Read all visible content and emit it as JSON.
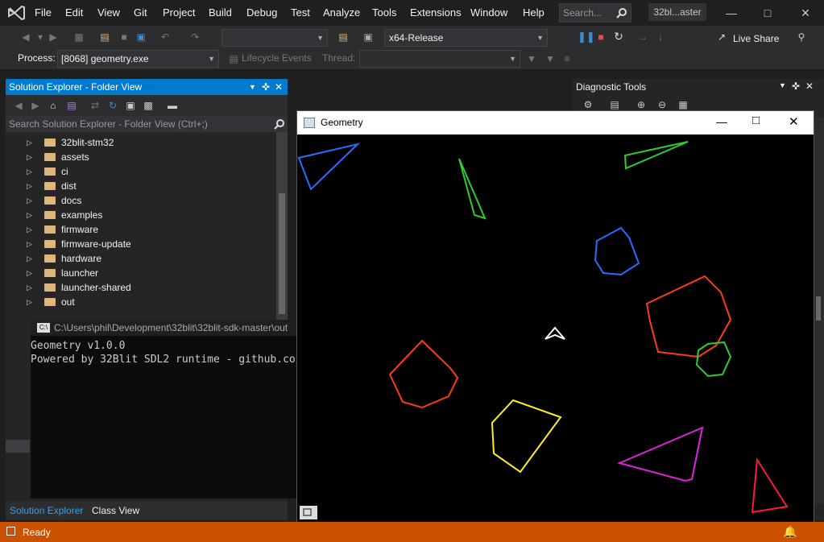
{
  "menu": [
    "File",
    "Edit",
    "View",
    "Git",
    "Project",
    "Build",
    "Debug",
    "Test",
    "Analyze",
    "Tools",
    "Extensions",
    "Window",
    "Help"
  ],
  "search": {
    "placeholder": "Search..."
  },
  "window_title": "32bl...aster",
  "toolbar": {
    "config_value": "",
    "platform_value": "x64-Release",
    "live_share_label": "Live Share"
  },
  "debug_bar": {
    "process_label": "Process:",
    "process_value": "[8068] geometry.exe",
    "lifecycle_label": "Lifecycle Events",
    "thread_label": "Thread:"
  },
  "solution_explorer": {
    "title": "Solution Explorer - Folder View",
    "search_placeholder": "Search Solution Explorer - Folder View (Ctrl+;)",
    "items": [
      "32blit-stm32",
      "assets",
      "ci",
      "dist",
      "docs",
      "examples",
      "firmware",
      "firmware-update",
      "hardware",
      "launcher",
      "launcher-shared",
      "out"
    ],
    "tabs": [
      "Solution Explorer",
      "Class View"
    ]
  },
  "console": {
    "title": "C:\\Users\\phil\\Development\\32blit\\32blit-sdk-master\\out",
    "lines": [
      "Geometry v1.0.0",
      "Powered by 32Blit SDL2 runtime - github.co"
    ]
  },
  "diagnostic_tools": {
    "title": "Diagnostic Tools"
  },
  "geometry_window": {
    "title": "Geometry",
    "colors": {
      "blue": "#2a6cff",
      "green": "#2ecc2e",
      "red": "#ff3a1a",
      "yellow": "#ffee22",
      "magenta": "#dd22dd",
      "crimson": "#ff1a3a",
      "white": "#ffffff"
    }
  },
  "status": {
    "text": "Ready"
  },
  "colors": {
    "accent": "#007acc",
    "status_bar": "#ca5100"
  }
}
